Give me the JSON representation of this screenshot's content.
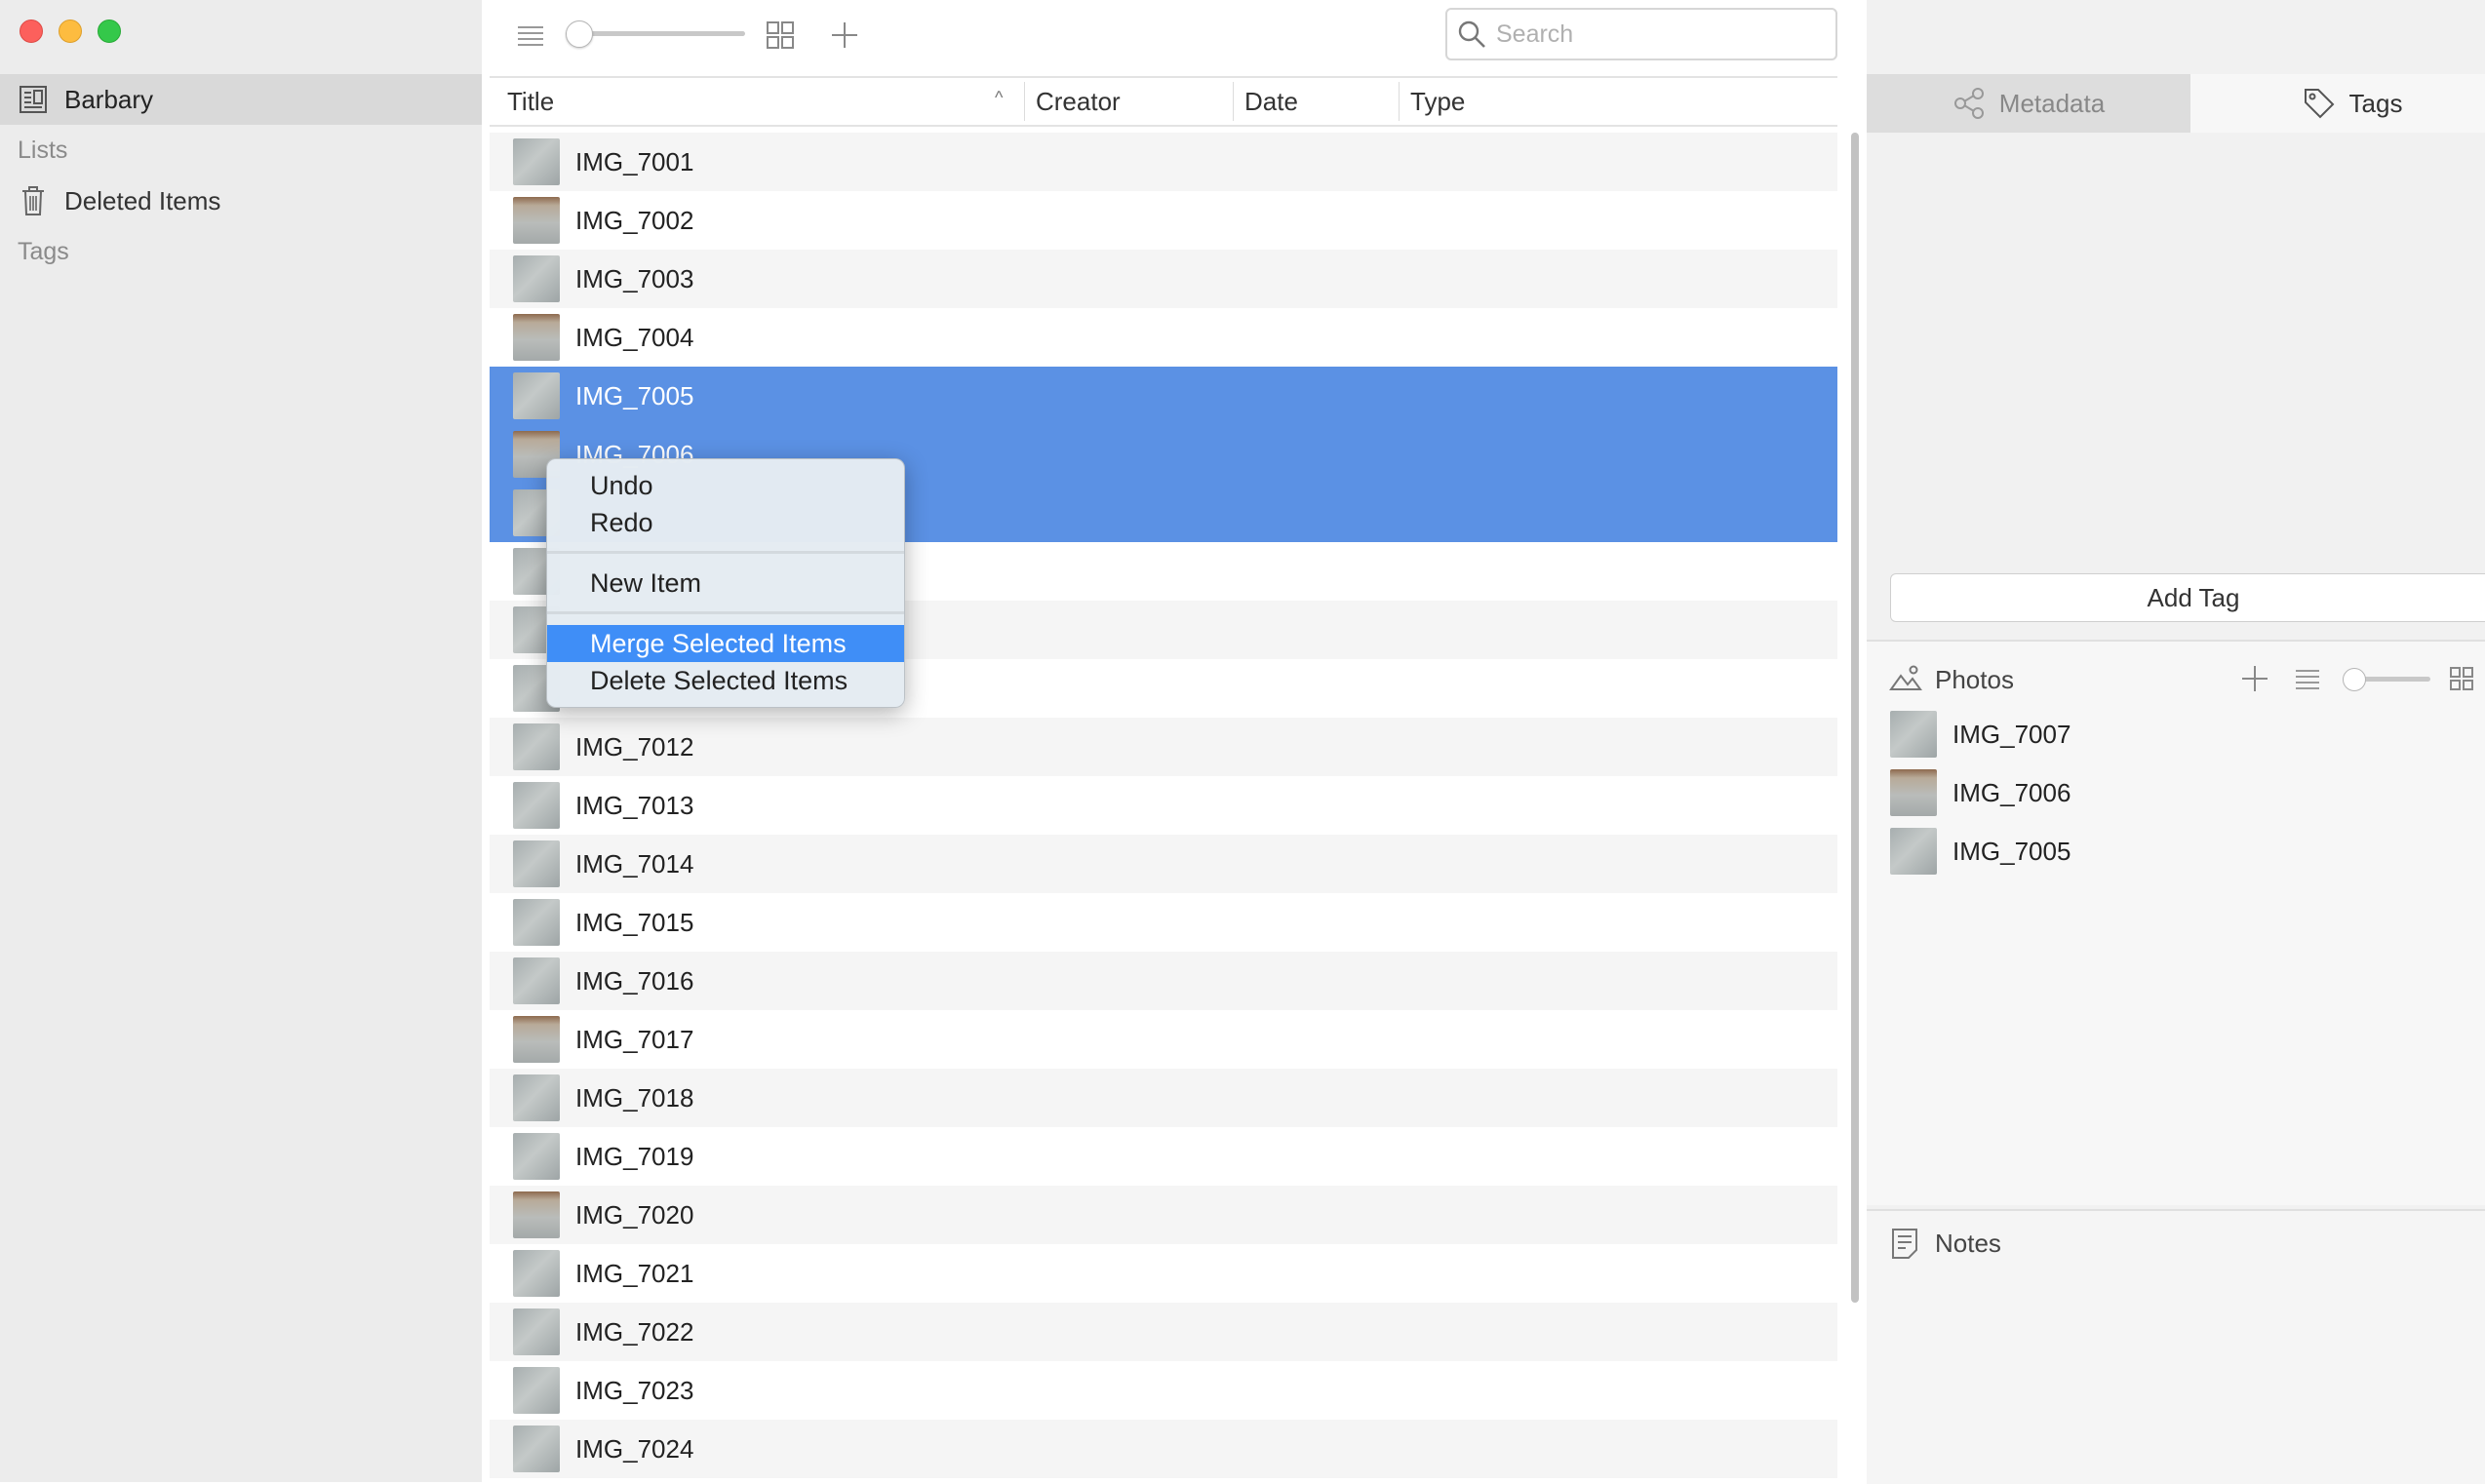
{
  "sidebar": {
    "project": "Barbary",
    "lists_heading": "Lists",
    "deleted_items": "Deleted Items",
    "tags_heading": "Tags"
  },
  "toolbar": {
    "search_placeholder": "Search"
  },
  "table": {
    "columns": [
      "Title",
      "Creator",
      "Date",
      "Type"
    ],
    "sort_indicator": "^",
    "rows": [
      {
        "title": "IMG_7001",
        "selected": false
      },
      {
        "title": "IMG_7002",
        "selected": false
      },
      {
        "title": "IMG_7003",
        "selected": false
      },
      {
        "title": "IMG_7004",
        "selected": false
      },
      {
        "title": "IMG_7005",
        "selected": true
      },
      {
        "title": "IMG_7006",
        "selected": true
      },
      {
        "title": "",
        "selected": true
      },
      {
        "title": "",
        "selected": false
      },
      {
        "title": "",
        "selected": false
      },
      {
        "title": "",
        "selected": false
      },
      {
        "title": "IMG_7012",
        "selected": false
      },
      {
        "title": "IMG_7013",
        "selected": false
      },
      {
        "title": "IMG_7014",
        "selected": false
      },
      {
        "title": "IMG_7015",
        "selected": false
      },
      {
        "title": "IMG_7016",
        "selected": false
      },
      {
        "title": "IMG_7017",
        "selected": false
      },
      {
        "title": "IMG_7018",
        "selected": false
      },
      {
        "title": "IMG_7019",
        "selected": false
      },
      {
        "title": "IMG_7020",
        "selected": false
      },
      {
        "title": "IMG_7021",
        "selected": false
      },
      {
        "title": "IMG_7022",
        "selected": false
      },
      {
        "title": "IMG_7023",
        "selected": false
      },
      {
        "title": "IMG_7024",
        "selected": false
      }
    ]
  },
  "context_menu": {
    "undo": "Undo",
    "redo": "Redo",
    "new_item": "New Item",
    "merge_selected": "Merge Selected Items",
    "delete_selected": "Delete Selected Items",
    "highlighted": "Merge Selected Items"
  },
  "right_panel": {
    "tab_metadata": "Metadata",
    "tab_tags": "Tags",
    "active_tab": "Tags",
    "add_tag": "Add Tag",
    "photos_title": "Photos",
    "photos": [
      "IMG_7007",
      "IMG_7006",
      "IMG_7005"
    ],
    "notes_title": "Notes"
  },
  "colors": {
    "selection": "#5b91e4",
    "menu_highlight": "#3f8ef7",
    "close": "#fc605c",
    "minimize": "#fdbc40",
    "maximize": "#34c84a"
  },
  "icons": [
    "project-icon",
    "trash-icon",
    "list-view-icon",
    "grid-view-icon",
    "plus-icon",
    "search-icon",
    "share-icon",
    "tag-icon",
    "photos-icon",
    "notes-icon"
  ]
}
